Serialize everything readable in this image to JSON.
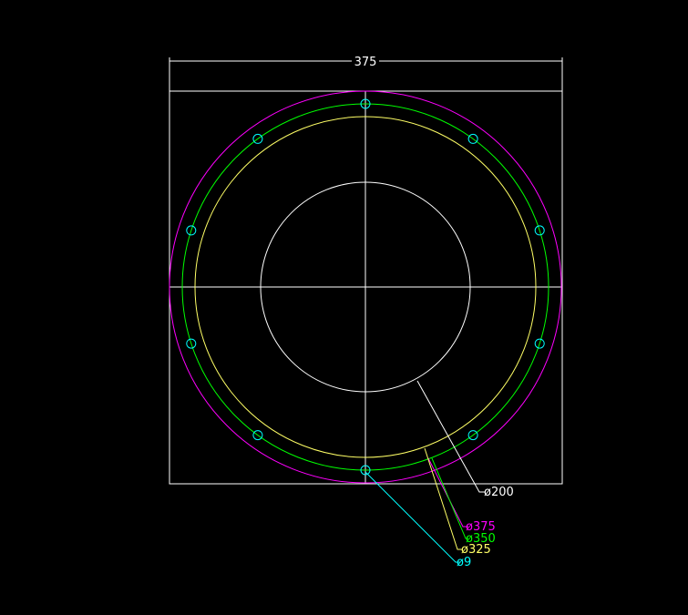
{
  "drawing": {
    "overall_dimension": "375",
    "labels": [
      {
        "id": "d200",
        "text": "ø200",
        "color": "#ffffff"
      },
      {
        "id": "d375",
        "text": "ø375",
        "color": "#ff00ff"
      },
      {
        "id": "d350",
        "text": "ø350",
        "color": "#00ff00"
      },
      {
        "id": "d325",
        "text": "ø325",
        "color": "#ffff66"
      },
      {
        "id": "d9",
        "text": "ø9",
        "color": "#00ffff"
      }
    ],
    "colors": {
      "background": "#000000",
      "outline": "#ffffff",
      "outer_circle": "#ff00ff",
      "bolt_circle": "#00ff00",
      "inner_ring": "#ffff66",
      "holes": "#00ffff"
    },
    "bolt_hole_count": 10
  }
}
